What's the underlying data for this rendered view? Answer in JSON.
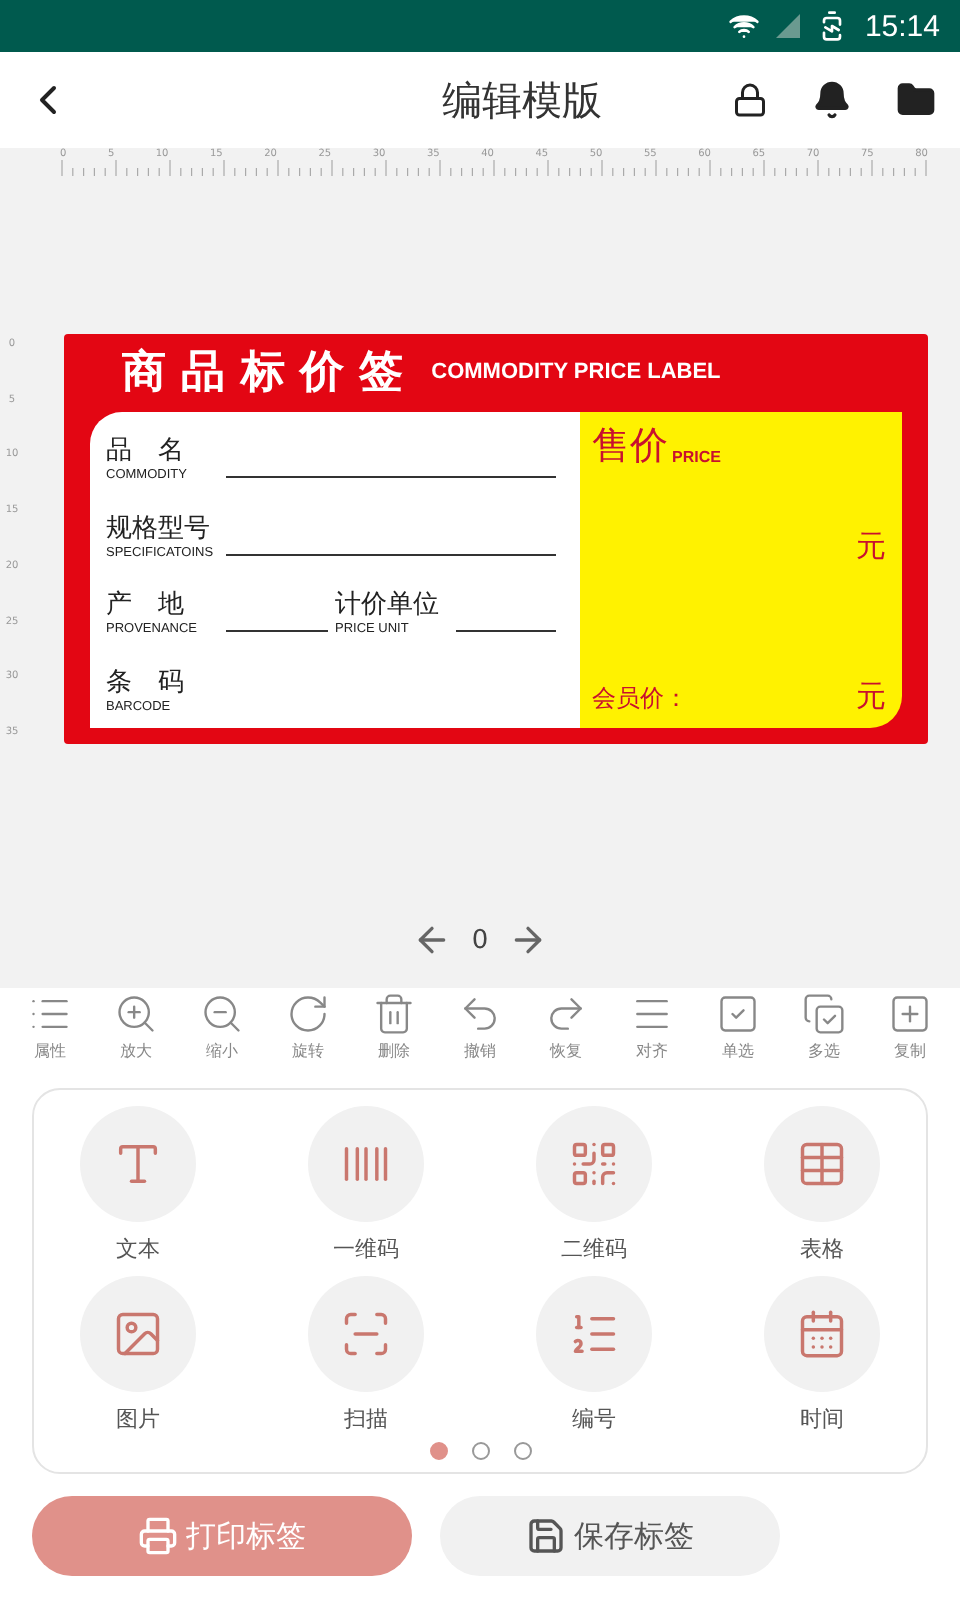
{
  "status_bar": {
    "time": "15:14"
  },
  "header": {
    "title": "编辑模版"
  },
  "ruler": {
    "h_ticks": [
      "0",
      "5",
      "10",
      "15",
      "20",
      "25",
      "30",
      "35",
      "40",
      "45",
      "50",
      "55",
      "60",
      "65",
      "70",
      "75",
      "80"
    ],
    "v_ticks": [
      "0",
      "5",
      "10",
      "15",
      "20",
      "25",
      "30",
      "35"
    ]
  },
  "label": {
    "title_cn": "商 品 标 价 签",
    "title_en": "COMMODITY PRICE LABEL",
    "fields": [
      {
        "kind": "line",
        "cn": "品　名",
        "en": "COMMODITY"
      },
      {
        "kind": "line",
        "cn": "规格型号",
        "en": "SPECIFICATOINS"
      },
      {
        "kind": "split",
        "cn": "产　地",
        "en": "PROVENANCE",
        "cn2": "计价单位",
        "en2": "PRICE UNIT"
      },
      {
        "kind": "plain",
        "cn": "条　码",
        "en": "BARCODE"
      }
    ],
    "price_cn": "售价",
    "price_en": "PRICE",
    "price_unit": "元",
    "member_label": "会员价：",
    "member_unit": "元"
  },
  "pager": {
    "page": "0"
  },
  "toolbar": [
    {
      "label": "属性"
    },
    {
      "label": "放大"
    },
    {
      "label": "缩小"
    },
    {
      "label": "旋转"
    },
    {
      "label": "删除"
    },
    {
      "label": "撤销"
    },
    {
      "label": "恢复"
    },
    {
      "label": "对齐"
    },
    {
      "label": "单选"
    },
    {
      "label": "多选"
    },
    {
      "label": "复制"
    }
  ],
  "tools": [
    {
      "label": "文本"
    },
    {
      "label": "一维码"
    },
    {
      "label": "二维码"
    },
    {
      "label": "表格"
    },
    {
      "label": "图片"
    },
    {
      "label": "扫描"
    },
    {
      "label": "编号"
    },
    {
      "label": "时间"
    }
  ],
  "tool_pages": [
    {
      "selected": true
    },
    {
      "selected": false
    },
    {
      "selected": false
    }
  ],
  "buttons": [
    {
      "kind": "primary",
      "label": "打印标签"
    },
    {
      "kind": "secondary",
      "label": "保存标签"
    }
  ]
}
